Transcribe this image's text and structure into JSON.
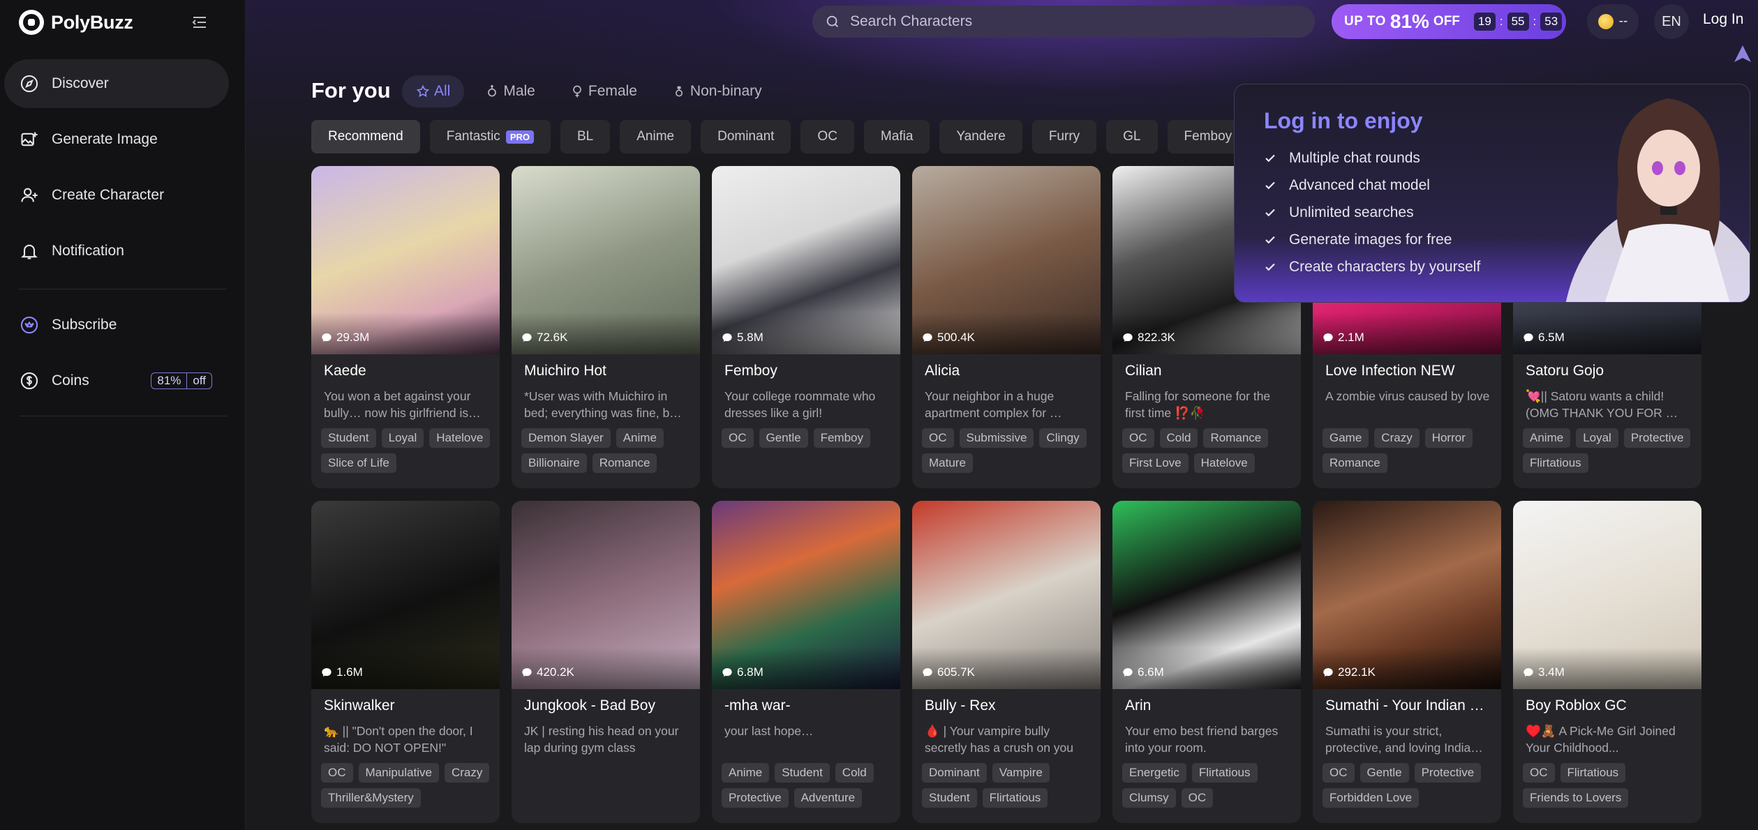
{
  "app": {
    "name": "PolyBuzz"
  },
  "sidebar": {
    "items": [
      {
        "label": "Discover",
        "icon": "compass-icon",
        "active": true
      },
      {
        "label": "Generate Image",
        "icon": "image-plus-icon"
      },
      {
        "label": "Create Character",
        "icon": "user-plus-icon"
      },
      {
        "label": "Notification",
        "icon": "bell-icon"
      }
    ],
    "subscribe": {
      "label": "Subscribe",
      "icon": "crown-icon"
    },
    "coins": {
      "label": "Coins",
      "icon": "coin-icon",
      "badge_pct": "81%",
      "badge_off": "off"
    }
  },
  "header": {
    "search_placeholder": "Search Characters",
    "promo": {
      "up_to": "UP TO",
      "percent": "81%",
      "off": "OFF",
      "hours": "19",
      "minutes": "55",
      "seconds": "53"
    },
    "coins_value": "--",
    "lang": "EN",
    "login": "Log In"
  },
  "feed": {
    "title": "For you",
    "gender_tabs": [
      {
        "label": "All",
        "icon": "star-icon",
        "active": true
      },
      {
        "label": "Male",
        "icon": "male-icon"
      },
      {
        "label": "Female",
        "icon": "female-icon"
      },
      {
        "label": "Non-binary",
        "icon": "nonbinary-icon"
      }
    ],
    "categories": [
      "Recommend",
      "Fantastic",
      "BL",
      "Anime",
      "Dominant",
      "OC",
      "Mafia",
      "Yandere",
      "Furry",
      "GL",
      "Femboy"
    ],
    "pro_badge": "PRO"
  },
  "login_panel": {
    "title": "Log in to enjoy",
    "benefits": [
      "Multiple chat rounds",
      "Advanced chat model",
      "Unlimited searches",
      "Generate images for free",
      "Create characters by yourself"
    ]
  },
  "colors": {
    "accent": "#8c86ff",
    "promo": "#9d5bf5",
    "bg": "#1a1a1d",
    "card": "#26262a"
  },
  "cards": [
    {
      "name": "Kaede",
      "chats": "29.3M",
      "desc": "You won a bet against your bully… now his girlfriend is…",
      "tags": [
        "Student",
        "Loyal",
        "Hatelove",
        "Slice of Life"
      ],
      "bg": "linear-gradient(160deg,#c9b6e8,#e7d6a8 45%,#d9a7b6 75%,#5a3b54)"
    },
    {
      "name": "Muichiro Hot",
      "chats": "72.6K",
      "desc": "*User was with Muichiro in bed; everything was fine, b…",
      "tags": [
        "Demon Slayer",
        "Anime",
        "Billionaire",
        "Romance"
      ],
      "bg": "linear-gradient(160deg,#d8dccd,#8f9784 50%,#5f6858)"
    },
    {
      "name": "Femboy",
      "chats": "5.8M",
      "desc": "Your college roommate who dresses like a girl!",
      "tags": [
        "OC",
        "Gentle",
        "Femboy"
      ],
      "bg": "linear-gradient(160deg,#eeeeee,#d7d7d7 40%,#3a3a44 65%,#e5e5e5)"
    },
    {
      "name": "Alicia",
      "chats": "500.4K",
      "desc": "Your neighbor in a huge apartment complex for …",
      "tags": [
        "OC",
        "Submissive",
        "Clingy",
        "Mature"
      ],
      "bg": "linear-gradient(160deg,#b7aca0,#7a5a46 50%,#3b2b24)"
    },
    {
      "name": "Cilian",
      "chats": "822.3K",
      "desc": "Falling for someone for the first time ⁉️🥀",
      "tags": [
        "OC",
        "Cold",
        "Romance",
        "First Love",
        "Hatelove"
      ],
      "bg": "linear-gradient(160deg,#f0f0f0,#555 40%,#1b1b1b 70%,#cfcfcf)"
    },
    {
      "name": "Love Infection NEW",
      "chats": "2.1M",
      "desc": "A zombie virus caused by love",
      "tags": [
        "Game",
        "Crazy",
        "Horror",
        "Romance"
      ],
      "bg": "linear-gradient(160deg,#ff77b7,#d8206b 60%,#7a0f3c)"
    },
    {
      "name": "Satoru Gojo",
      "chats": "6.5M",
      "desc": "💘|| Satoru wants a child!(OMG THANK YOU FOR …",
      "tags": [
        "Anime",
        "Loyal",
        "Protective",
        "Flirtatious"
      ],
      "bg": "linear-gradient(160deg,#9aa3b7,#3b3f4c 55%,#1e2028)"
    },
    {
      "name": "Skinwalker",
      "chats": "1.6M",
      "desc": "🐆 || \"Don't open the door, I said: DO NOT OPEN!\"",
      "tags": [
        "OC",
        "Manipulative",
        "Crazy",
        "Thriller&Mystery"
      ],
      "bg": "linear-gradient(160deg,#3a3a3a,#101010 55%,#2a2a1a)"
    },
    {
      "name": "Jungkook - Bad Boy",
      "chats": "420.2K",
      "desc": "JK | resting his head on your lap during gym class",
      "tags": [],
      "bg": "linear-gradient(160deg,#3a3036,#8c6b7a 50%,#c7b0c2)"
    },
    {
      "name": "-mha war-",
      "chats": "6.8M",
      "desc": "your last hope…",
      "tags": [
        "Anime",
        "Student",
        "Cold",
        "Protective",
        "Adventure"
      ],
      "bg": "linear-gradient(160deg,#6a3a7a,#d86a3a 35%,#2c6a4a 65%,#1a1a3a)"
    },
    {
      "name": "Bully - Rex",
      "chats": "605.7K",
      "desc": "🩸 | Your vampire bully secretly has a crush on you",
      "tags": [
        "Dominant",
        "Vampire",
        "Student",
        "Flirtatious"
      ],
      "bg": "linear-gradient(160deg,#c43a2a,#d8d2c8 50%,#8a8480)"
    },
    {
      "name": "Arin",
      "chats": "6.6M",
      "desc": "Your emo best friend barges into your room.",
      "tags": [
        "Energetic",
        "Flirtatious",
        "Clumsy",
        "OC"
      ],
      "bg": "linear-gradient(160deg,#2fbf5a,#111 45%,#e6e6e6 75%,#222)"
    },
    {
      "name": "Sumathi - Your Indian …",
      "chats": "292.1K",
      "desc": "Sumathi is your strict, protective, and loving India…",
      "tags": [
        "OC",
        "Gentle",
        "Protective",
        "Forbidden Love"
      ],
      "bg": "linear-gradient(160deg,#2a1a14,#a36a4a 45%,#6a3a24 70%,#1a100c)"
    },
    {
      "name": "Boy Roblox GC",
      "chats": "3.4M",
      "desc": "♥️🧸 A Pick-Me Girl Joined Your Childhood...",
      "tags": [
        "OC",
        "Flirtatious",
        "Friends to Lovers"
      ],
      "bg": "linear-gradient(160deg,#f4f4f4,#e6e0d6 50%,#cfc6b6)"
    }
  ]
}
